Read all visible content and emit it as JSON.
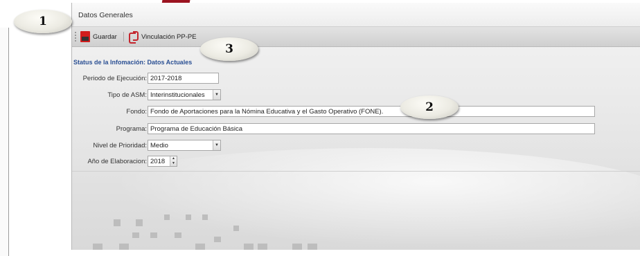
{
  "window": {
    "title": "Datos Generales"
  },
  "toolbar": {
    "save_label": "Guardar",
    "link_label": "Vinculación PP-PE"
  },
  "status_title": "Status de la Infomación: Datos Actuales",
  "form": {
    "periodo": {
      "label": "Periodo de Ejecución:",
      "value": "2017-2018"
    },
    "tipo": {
      "label": "Tipo de ASM:",
      "value": "Interinstitucionales"
    },
    "fondo": {
      "label": "Fondo:",
      "value": "Fondo de Aportaciones para la Nómina Educativa y el Gasto Operativo (FONE)."
    },
    "programa": {
      "label": "Programa:",
      "value": "Programa de Educación Básica"
    },
    "nivel": {
      "label": "Nivel de Prioridad:",
      "value": "Medio"
    },
    "anio": {
      "label": "Año de Elaboracion:",
      "value": "2018"
    }
  },
  "badges": {
    "b1": "1",
    "b2": "2",
    "b3": "3"
  },
  "colors": {
    "accent_red": "#9b1320",
    "section_title_blue": "#2a4f93"
  }
}
